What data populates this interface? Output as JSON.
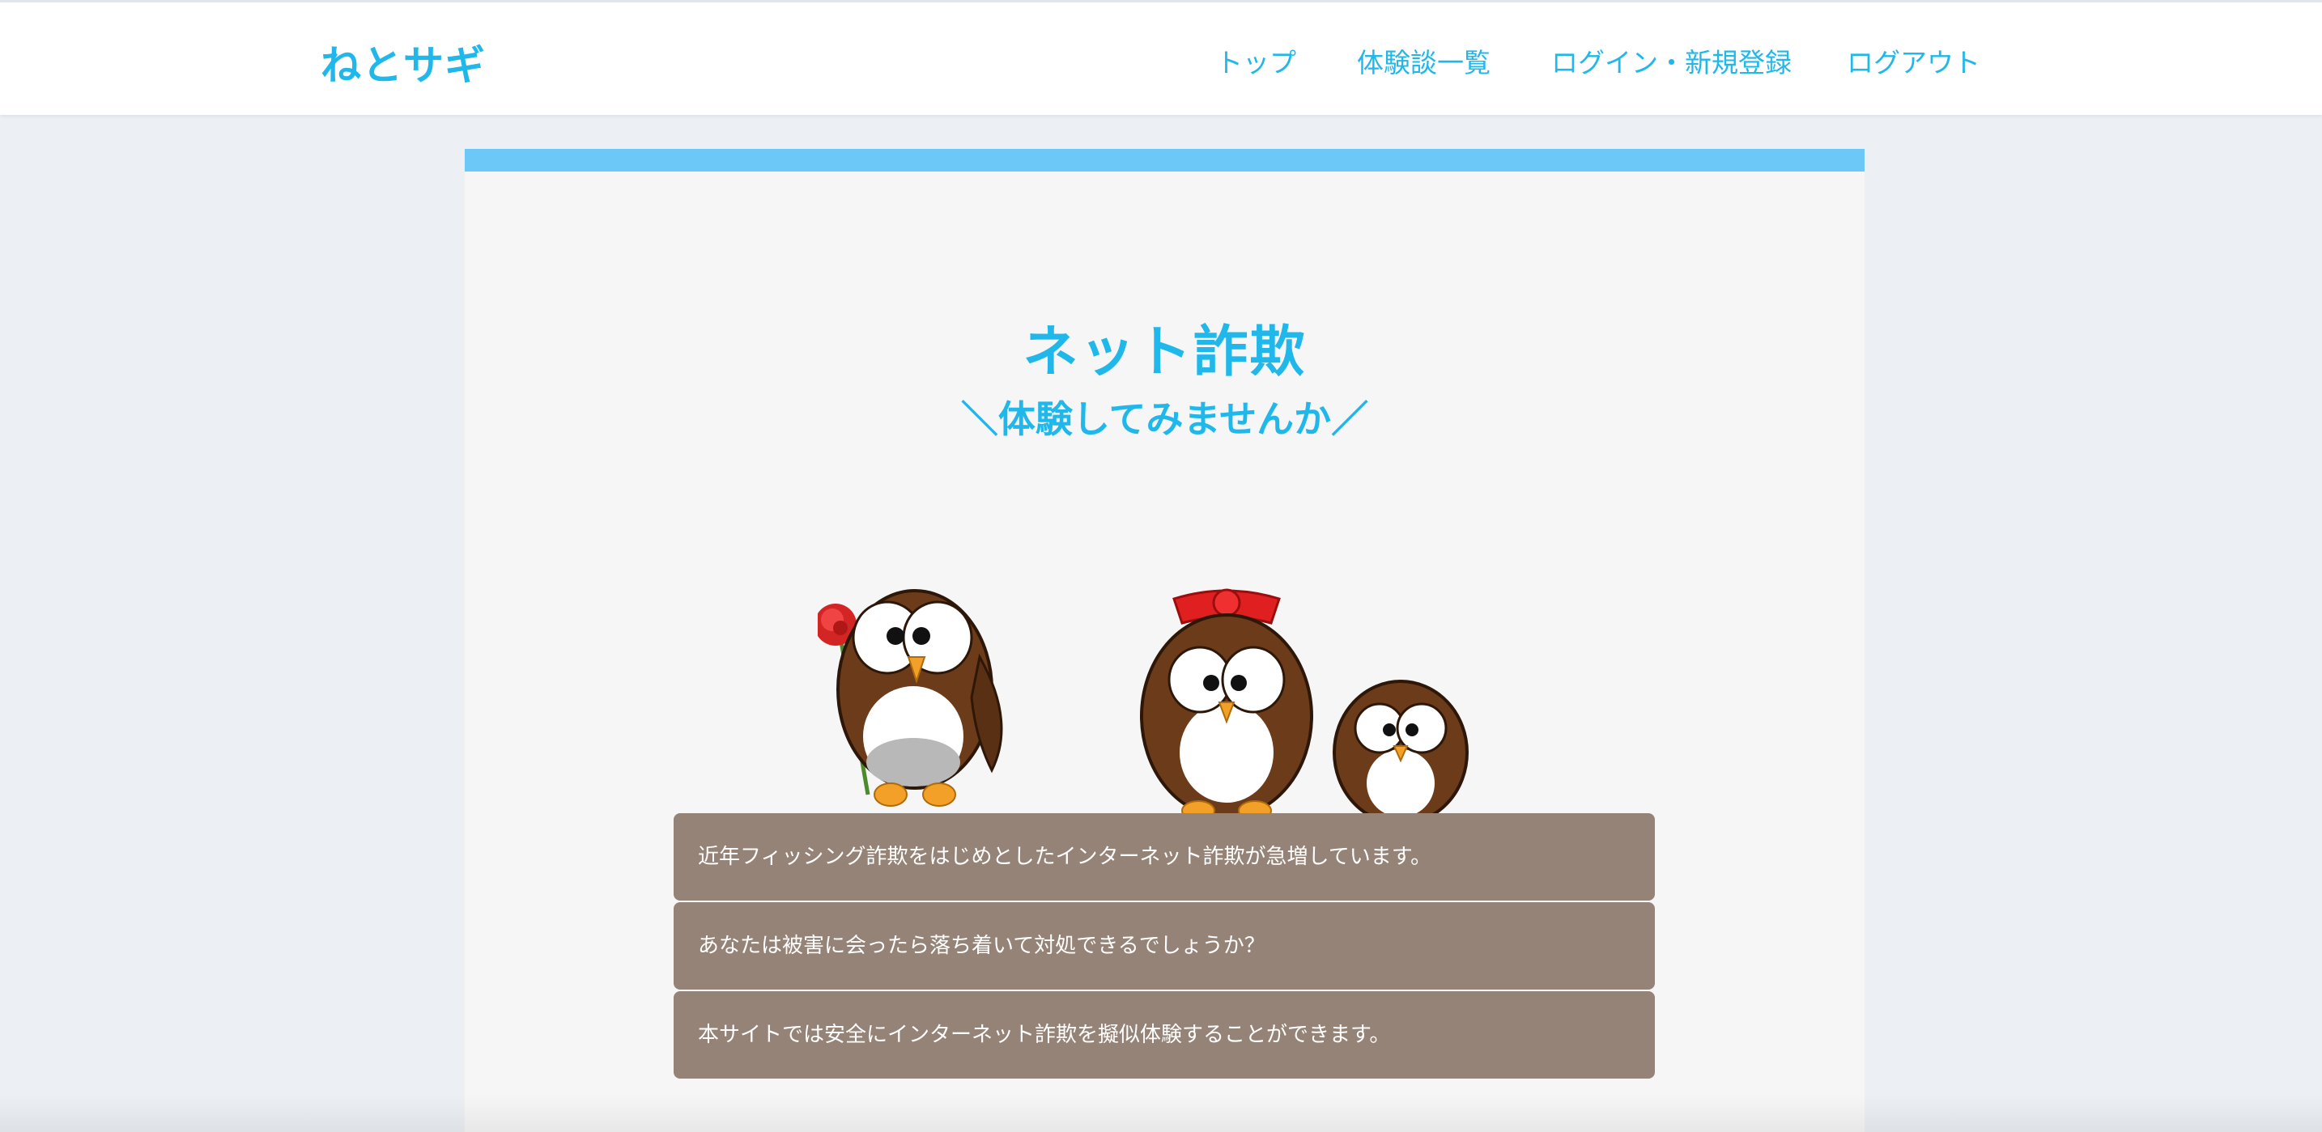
{
  "header": {
    "logo": "ねとサギ",
    "nav": [
      {
        "label": "トップ"
      },
      {
        "label": "体験談一覧"
      },
      {
        "label": "ログイン・新規登録"
      },
      {
        "label": "ログアウト"
      }
    ]
  },
  "hero": {
    "title": "ネット詐欺",
    "subtitle": "＼体験してみませんか／",
    "image_icon": "owl-family-illustration"
  },
  "messages": [
    {
      "text": "近年フィッシング詐欺をはじめとしたインターネット詐欺が急増しています。"
    },
    {
      "text": "あなたは被害に会ったら落ち着いて対処できるでしょうか？"
    },
    {
      "text": "本サイトでは安全にインターネット詐欺を擬似体験することができます。"
    }
  ],
  "colors": {
    "accent": "#20b8ea",
    "bar": "#6cc8f6",
    "message_bg": "#958377",
    "page_bg": "#eceff3",
    "card_bg": "#f6f6f7"
  }
}
